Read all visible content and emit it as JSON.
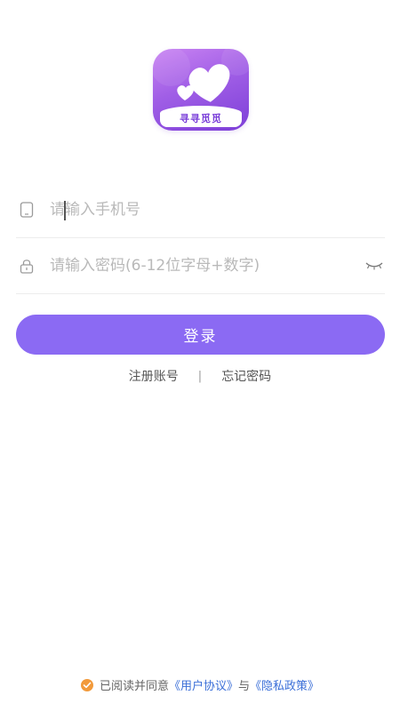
{
  "logo": {
    "text": "寻寻觅觅"
  },
  "phone": {
    "placeholder": "请输入手机号",
    "value": ""
  },
  "password": {
    "placeholder": "请输入密码(6-12位字母+数字)",
    "value": ""
  },
  "login_label": "登录",
  "links": {
    "register": "注册账号",
    "separator": "|",
    "forgot": "忘记密码"
  },
  "agreement": {
    "prefix": "已阅读并同意",
    "user_agreement": "《用户协议》",
    "conjunction": "与",
    "privacy_policy": "《隐私政策》"
  },
  "colors": {
    "accent": "#8b6af3",
    "check": "#f29a3b",
    "link": "#3b6fd8"
  }
}
